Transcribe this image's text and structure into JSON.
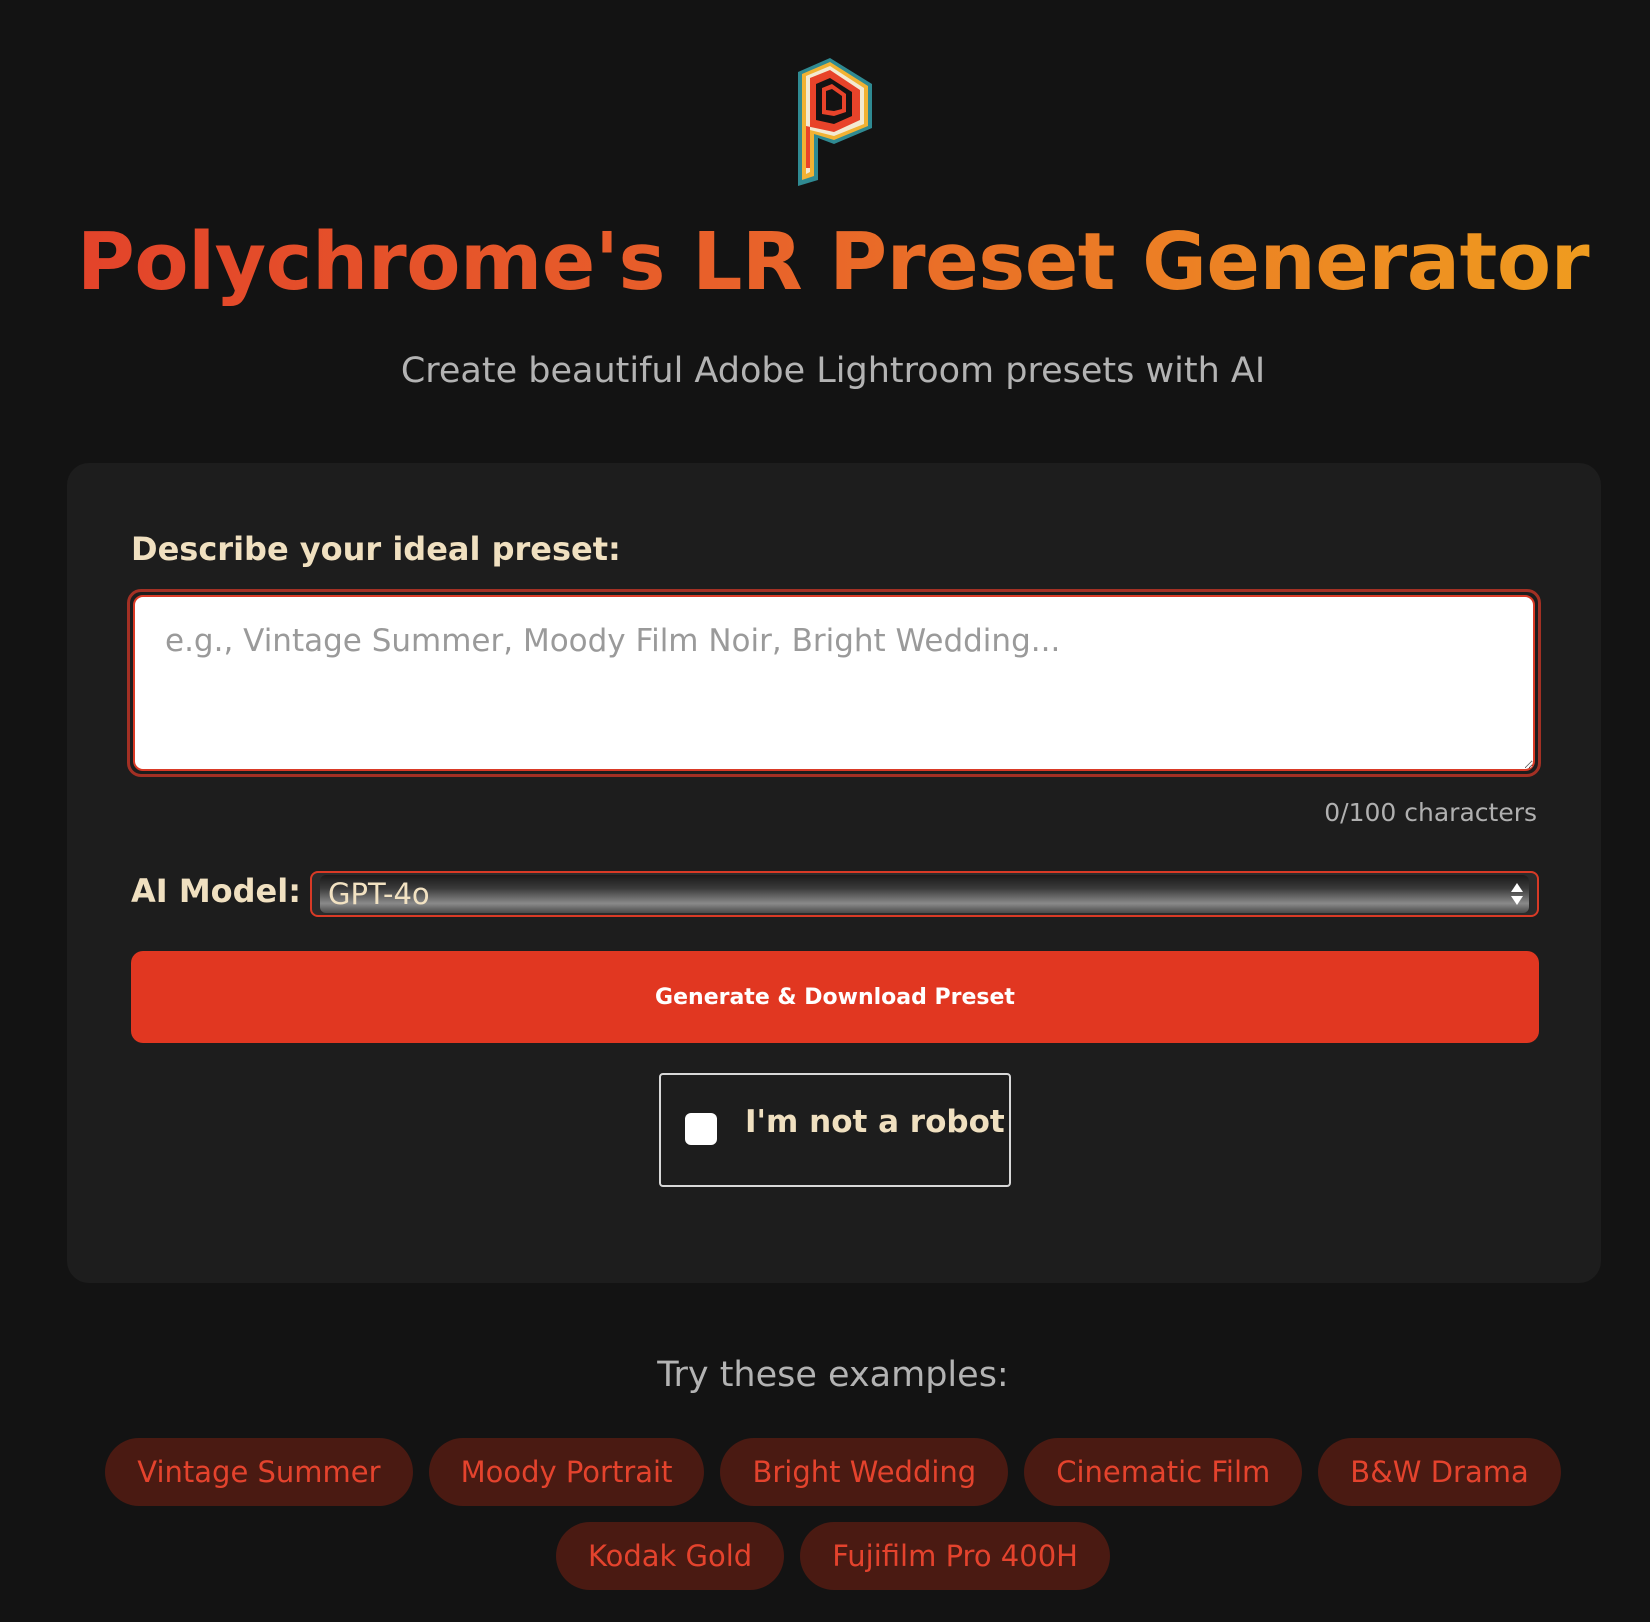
{
  "header": {
    "title": "Polychrome's LR Preset Generator",
    "subtitle": "Create beautiful Adobe Lightroom presets with AI",
    "logo_icon": "polychrome-p-logo"
  },
  "form": {
    "description_label": "Describe your ideal preset:",
    "description_placeholder": "e.g., Vintage Summer, Moody Film Noir, Bright Wedding...",
    "description_value": "",
    "char_count": "0/100 characters",
    "model_label": "AI Model:",
    "model_selected": "GPT-4o",
    "generate_button": "Generate & Download Preset",
    "captcha_label": "I'm not a robot"
  },
  "examples": {
    "heading": "Try these examples:",
    "items": [
      "Vintage Summer",
      "Moody Portrait",
      "Bright Wedding",
      "Cinematic Film",
      "B&W Drama",
      "Kodak Gold",
      "Fujifilm Pro 400H"
    ]
  },
  "colors": {
    "background": "#131313",
    "card": "#1d1d1d",
    "accent": "#e13721",
    "chip_bg": "#4a1a12",
    "label": "#f0e0c0"
  }
}
